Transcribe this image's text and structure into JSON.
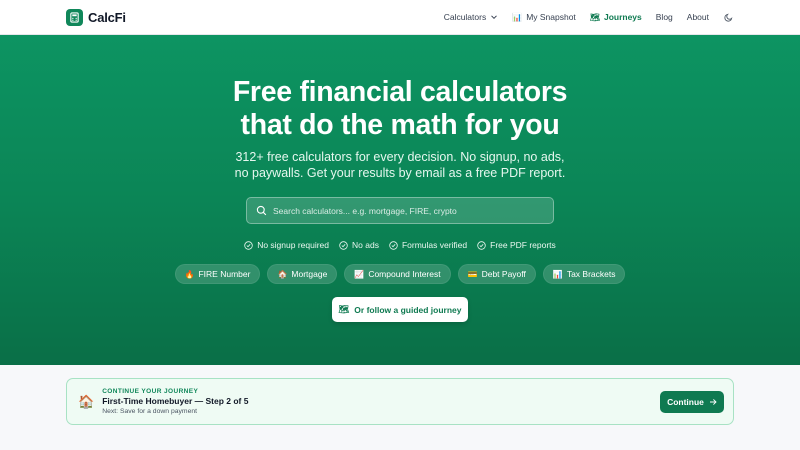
{
  "header": {
    "brand": "CalcFi",
    "nav": [
      {
        "label": "Calculators",
        "emoji": "",
        "active": false
      },
      {
        "label": "My Snapshot",
        "emoji": "📊",
        "active": false
      },
      {
        "label": "Journeys",
        "emoji": "🗺",
        "active": true
      },
      {
        "label": "Blog",
        "emoji": "",
        "active": false
      },
      {
        "label": "About",
        "emoji": "",
        "active": false
      }
    ]
  },
  "hero": {
    "title_line1": "Free financial calculators",
    "title_line2": "that do the math for you",
    "subtitle": "312+ free calculators for every decision. No signup, no ads, no paywalls. Get your results by email as a free PDF report.",
    "search_placeholder": "Search calculators... e.g. mortgage, FIRE, crypto",
    "features": [
      "No signup required",
      "No ads",
      "Formulas verified",
      "Free PDF reports"
    ],
    "chips": [
      {
        "emoji": "🔥",
        "label": "FIRE Number"
      },
      {
        "emoji": "🏠",
        "label": "Mortgage"
      },
      {
        "emoji": "📈",
        "label": "Compound Interest"
      },
      {
        "emoji": "💳",
        "label": "Debt Payoff"
      },
      {
        "emoji": "📊",
        "label": "Tax Brackets"
      }
    ],
    "journey_emoji": "🗺",
    "journey_button": "Or follow a guided journey"
  },
  "continue_card": {
    "emoji": "🏠",
    "kicker": "CONTINUE YOUR JOURNEY",
    "title": "First-Time Homebuyer — Step 2 of 5",
    "next": "Next: Save for a down payment",
    "button": "Continue"
  },
  "colors": {
    "brand_green": "#0f7a51",
    "hero_top": "#0d9462",
    "hero_bottom": "#0a6f47",
    "card_bg": "#effbf4"
  }
}
